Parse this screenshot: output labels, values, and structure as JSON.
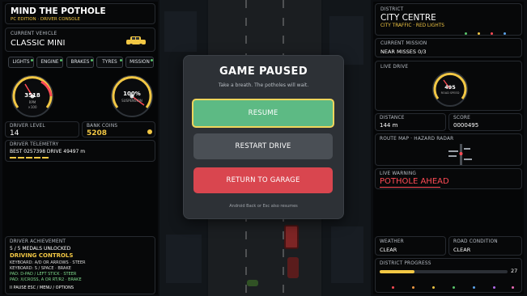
{
  "left": {
    "title": "MIND THE POTHOLE",
    "subtitle": "PC EDITION · DRIVER CONSOLE",
    "vehicle_label": "CURRENT VEHICLE",
    "vehicle_name": "CLASSIC MINI",
    "tabs": [
      "LIGHTS",
      "ENGINE",
      "BRAKES",
      "TYRES",
      "MISSION"
    ],
    "rpm": {
      "value": "3518",
      "unit": "RPM",
      "sub": "×100"
    },
    "suspension": {
      "value": "100%",
      "unit": "SUSPENSION",
      "level": 1.0
    },
    "driver_level_label": "DRIVER LEVEL",
    "driver_level": "14",
    "bank_label": "BANK COINS",
    "bank_value": "5208",
    "telemetry_label": "DRIVER TELEMETRY",
    "telemetry_value": "BEST 0257398   DRIVE 49497 m",
    "achievement_label": "DRIVER ACHIEVEMENT",
    "achievement_value": "5 / 5 MEDALS UNLOCKED",
    "controls_title": "DRIVING CONTROLS",
    "controls": [
      "KEYBOARD: A/D OR ARROWS · STEER",
      "KEYBOARD: S / SPACE · BRAKE",
      "PAD: D-PAD / LEFT STICK · STEER",
      "PAD: X/CROSS, A OR RT/R2 · BRAKE"
    ],
    "footer": "II PAUSE   ESC / MENU / OPTIONS"
  },
  "modal": {
    "title": "GAME PAUSED",
    "subtitle": "Take a breath. The potholes will wait.",
    "resume": "RESUME",
    "restart": "RESTART DRIVE",
    "garage": "RETURN TO GARAGE",
    "hint": "Android Back or Esc also resumes"
  },
  "right": {
    "district_label": "DISTRICT",
    "district_name": "CITY CENTRE",
    "district_tags": "CITY TRAFFIC · RED LIGHTS",
    "mission_label": "CURRENT MISSION",
    "mission_value": "NEAR MISSES 0/3",
    "live_drive_label": "LIVE DRIVE",
    "live_gauge_value": "495",
    "live_gauge_unit": "ROAD SPEED",
    "distance_label": "DISTANCE",
    "distance_value": "144 m",
    "score_label": "SCORE",
    "score_value": "0000495",
    "route_label": "ROUTE MAP · HAZARD RADAR",
    "warning_label": "LIVE WARNING",
    "warning_value": "POTHOLE AHEAD",
    "weather_label": "WEATHER",
    "weather_value": "CLEAR",
    "road_label": "ROAD CONDITION",
    "road_value": "CLEAR",
    "progress_label": "DISTRICT PROGRESS",
    "progress_value": "27",
    "progress_fraction": 0.27
  },
  "colors": {
    "accent": "#f2c744",
    "resume": "#5dba84",
    "garage": "#d9464f",
    "warning": "#ff4b55"
  }
}
